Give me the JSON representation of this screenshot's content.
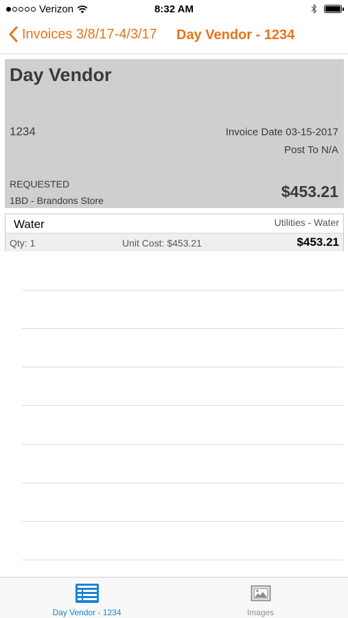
{
  "status_bar": {
    "carrier": "Verizon",
    "time": "8:32 AM"
  },
  "nav": {
    "back_label": "Invoices 3/8/17-4/3/17",
    "title": "Day Vendor - 1234",
    "accent_color": "#e8731c"
  },
  "invoice": {
    "vendor_name": "Day Vendor",
    "number": "1234",
    "invoice_date": "Invoice Date 03-15-2017",
    "post_to": "Post To N/A",
    "status": "REQUESTED",
    "store": "1BD - Brandons Store",
    "total": "$453.21"
  },
  "line_items": [
    {
      "name": "Water",
      "category": "Utilities - Water",
      "qty": "Qty: 1",
      "unit_cost": "Unit Cost:  $453.21",
      "total": "$453.21"
    }
  ],
  "tabs": [
    {
      "label": "Day Vendor - 1234",
      "icon": "list-icon",
      "active": true,
      "color": "#1a82d6"
    },
    {
      "label": "Images",
      "icon": "image-icon",
      "active": false,
      "color": "#8e8e8e"
    }
  ]
}
